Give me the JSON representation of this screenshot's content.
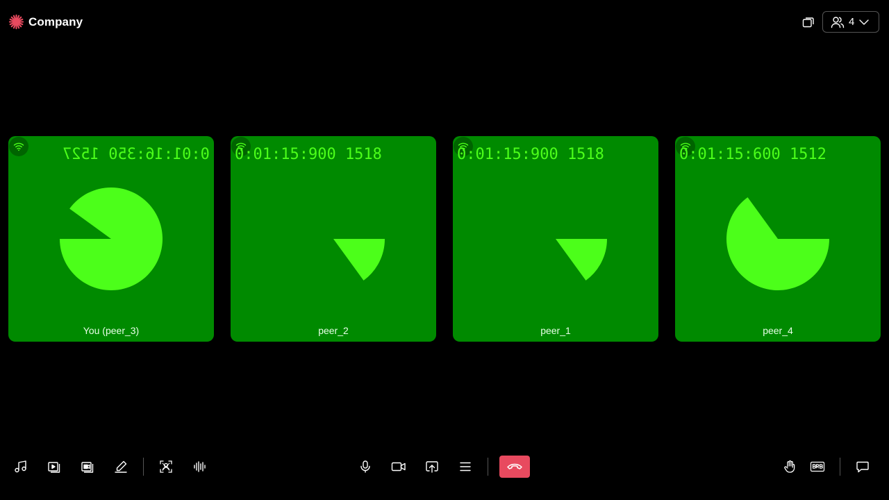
{
  "header": {
    "brand": "Company",
    "participants_count": "4"
  },
  "tiles": [
    {
      "timer": "0:01:16:350 1527",
      "name": "You (peer_3)",
      "mirrored": true,
      "pie_start_deg": 216,
      "pie_sweep_deg": 324
    },
    {
      "timer": "0:01:15:900 1518",
      "name": "peer_2",
      "mirrored": false,
      "pie_start_deg": 0,
      "pie_sweep_deg": 54
    },
    {
      "timer": "0:01:15:900 1518",
      "name": "peer_1",
      "mirrored": false,
      "pie_start_deg": 0,
      "pie_sweep_deg": 54
    },
    {
      "timer": "0:01:15:600 1512",
      "name": "peer_4",
      "mirrored": false,
      "pie_start_deg": 0,
      "pie_sweep_deg": 234
    }
  ],
  "colors": {
    "tile_bg": "#008a00",
    "pie": "#4cff1a",
    "hangup": "#e84a5f",
    "brand_icon": "#e84a5f"
  },
  "toolbar": {
    "left_icons": [
      "music-icon",
      "play-video-icon",
      "video-library-icon",
      "whiteboard-pen-icon",
      "virtual-background-icon",
      "audio-waveform-icon"
    ],
    "center_icons": [
      "microphone-icon",
      "camera-icon",
      "screen-share-icon",
      "menu-icon",
      "hangup-icon"
    ],
    "right_icons": [
      "raise-hand-icon",
      "brb-icon",
      "chat-icon"
    ]
  }
}
